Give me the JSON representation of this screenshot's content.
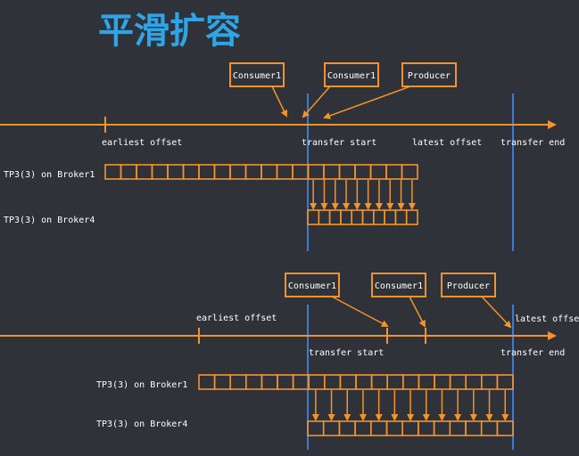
{
  "title": "平滑扩容",
  "colors": {
    "background": "#2f3238",
    "accent": "#f5932b",
    "title": "#2fa4e7",
    "marker": "#3b7bd8",
    "label": "#ffffff"
  },
  "diagrams": [
    {
      "id": "top",
      "callouts": [
        {
          "label": "Consumer1"
        },
        {
          "label": "Consumer1"
        },
        {
          "label": "Producer"
        }
      ],
      "axis_labels": {
        "earliest": "earliest offset",
        "transfer_start": "transfer start",
        "latest": "latest offset",
        "transfer_end": "transfer end"
      },
      "broker1": {
        "label": "TP3(3) on Broker1",
        "cells": 20
      },
      "broker4": {
        "label": "TP3(3) on Broker4",
        "cells": 10
      },
      "copy_arrows": 10
    },
    {
      "id": "bottom",
      "callouts": [
        {
          "label": "Consumer1"
        },
        {
          "label": "Consumer1"
        },
        {
          "label": "Producer"
        }
      ],
      "axis_labels": {
        "earliest": "earliest offset",
        "transfer_start": "transfer start",
        "latest": "latest offset",
        "transfer_end": "transfer end"
      },
      "broker1": {
        "label": "TP3(3) on Broker1",
        "cells": 20
      },
      "broker4": {
        "label": "TP3(3) on Broker4",
        "cells": 13
      },
      "copy_arrows": 13
    }
  ]
}
